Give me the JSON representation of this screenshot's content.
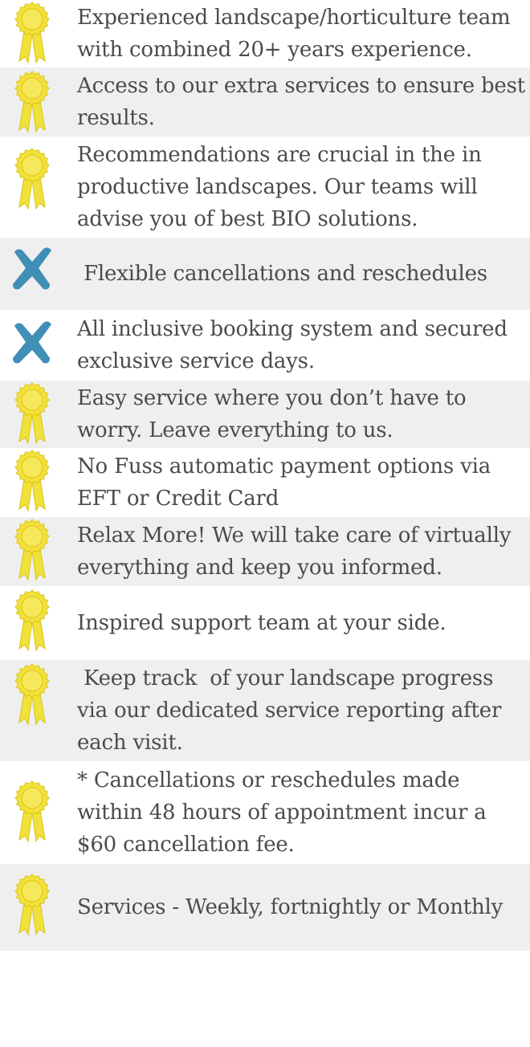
{
  "colors": {
    "rosette_fill": "#f2e13a",
    "rosette_edge": "#d9c316",
    "rosette_center": "#f6e85a",
    "cross": "#3f8fb6",
    "row_shade": "#efefef",
    "text": "#4b4b4b"
  },
  "features": [
    {
      "icon": "rosette-icon",
      "text": "Experienced landscape/horticulture team with combined 20+ years experience."
    },
    {
      "icon": "rosette-icon",
      "text": "Access to our extra services to ensure best results."
    },
    {
      "icon": "rosette-icon",
      "text": "Recommendations are crucial in the in productive landscapes. Our teams will advise you of best BIO solutions."
    },
    {
      "icon": "cross-icon",
      "text": " Flexible cancellations and reschedules"
    },
    {
      "icon": "cross-icon",
      "text": "All inclusive booking system and secured exclusive service days."
    },
    {
      "icon": "rosette-icon",
      "text": "Easy service where you don’t have to worry. Leave everything to us."
    },
    {
      "icon": "rosette-icon",
      "text": "No Fuss automatic payment options via EFT or Credit Card"
    },
    {
      "icon": "rosette-icon",
      "text": "Relax More! We will take care of virtually everything and keep you informed."
    },
    {
      "icon": "rosette-icon",
      "text": "Inspired support team at your side."
    },
    {
      "icon": "rosette-icon",
      "text": " Keep track  of your landscape progress via our dedicated service reporting after each visit."
    },
    {
      "icon": "rosette-icon",
      "text": "* Cancellations or reschedules made within 48 hours of appointment incur a $60 cancellation fee."
    },
    {
      "icon": "rosette-icon",
      "text": "Services - Weekly, fortnightly or Monthly"
    }
  ]
}
